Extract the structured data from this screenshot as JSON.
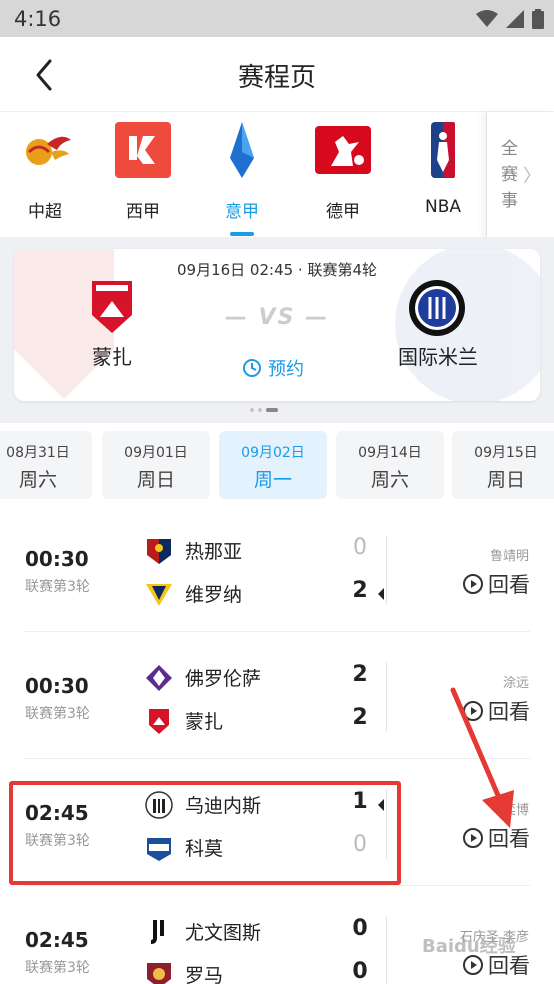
{
  "status": {
    "time": "4:16"
  },
  "header": {
    "title": "赛程页"
  },
  "leagues": [
    {
      "name": "中超",
      "active": false
    },
    {
      "name": "西甲",
      "active": false
    },
    {
      "name": "意甲",
      "active": true
    },
    {
      "name": "德甲",
      "active": false
    },
    {
      "name": "NBA",
      "active": false
    }
  ],
  "all_events": {
    "label": "全赛事"
  },
  "featured": {
    "info": "09月16日 02:45 · 联赛第4轮",
    "vs": "— VS —",
    "home": "蒙扎",
    "away": "国际米兰",
    "remind_label": "预约"
  },
  "dates": [
    {
      "date": "08月31日",
      "weekday": "周六",
      "active": false
    },
    {
      "date": "09月01日",
      "weekday": "周日",
      "active": false
    },
    {
      "date": "09月02日",
      "weekday": "周一",
      "active": true
    },
    {
      "date": "09月14日",
      "weekday": "周六",
      "active": false
    },
    {
      "date": "09月15日",
      "weekday": "周日",
      "active": false
    }
  ],
  "matches": [
    {
      "time": "00:30",
      "round": "联赛第3轮",
      "home": "热那亚",
      "home_score": "0",
      "away": "维罗纳",
      "away_score": "2",
      "commentator": "鲁靖明",
      "replay_label": "回看"
    },
    {
      "time": "00:30",
      "round": "联赛第3轮",
      "home": "佛罗伦萨",
      "home_score": "2",
      "away": "蒙扎",
      "away_score": "2",
      "commentator": "涂远",
      "replay_label": "回看"
    },
    {
      "time": "02:45",
      "round": "联赛第3轮",
      "home": "乌迪内斯",
      "home_score": "1",
      "away": "科莫",
      "away_score": "0",
      "commentator": "奕博",
      "replay_label": "回看"
    },
    {
      "time": "02:45",
      "round": "联赛第3轮",
      "home": "尤文图斯",
      "home_score": "0",
      "away": "罗马",
      "away_score": "0",
      "commentator": "石庆圣 李彦",
      "replay_label": "回看"
    }
  ],
  "colors": {
    "accent": "#1a9be6",
    "highlight": "#e53935"
  },
  "watermark": "Baidu经验"
}
